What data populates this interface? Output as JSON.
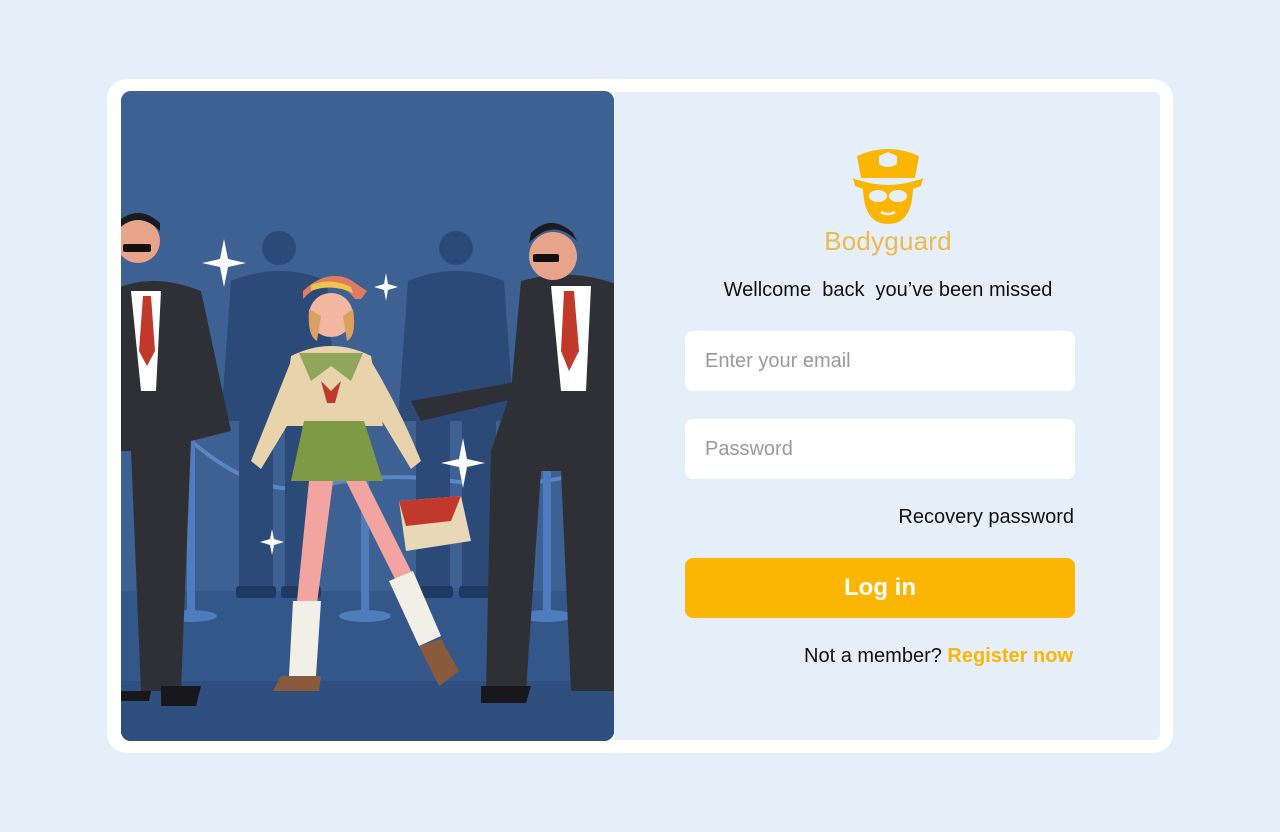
{
  "brand": {
    "name": "Bodyguard",
    "logo_icon": "bodyguard-face-icon",
    "color": "#efb84b"
  },
  "login": {
    "welcome_text": "Wellcome  back  you’ve been missed",
    "email_placeholder": "Enter your email",
    "password_placeholder": "Password",
    "recovery_label": "Recovery password",
    "submit_label": "Log in",
    "register_prompt": "Not a member?",
    "register_link": "Register now"
  },
  "colors": {
    "accent": "#fbb603",
    "page_background": "#e5eff9",
    "illustration_background": "#3d6193"
  }
}
